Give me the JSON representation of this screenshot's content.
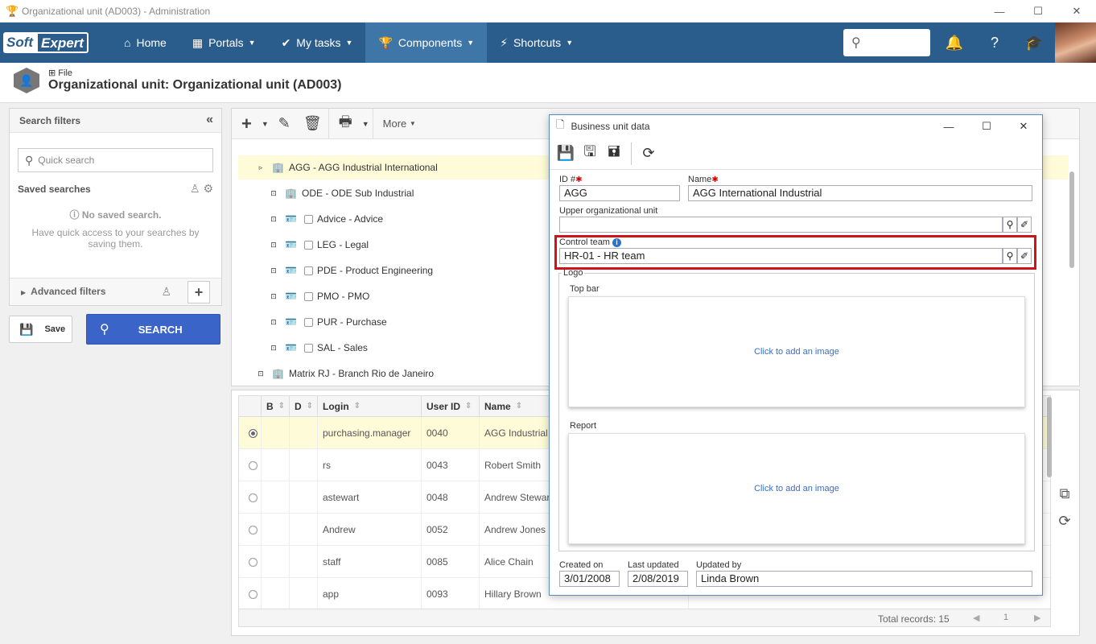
{
  "window": {
    "title": "Organizational unit (AD003) - Administration"
  },
  "nav": {
    "logo_soft": "Soft",
    "logo_expert": "Expert",
    "items": [
      {
        "label": "Home",
        "icon": "home-icon"
      },
      {
        "label": "Portals",
        "icon": "grid-icon"
      },
      {
        "label": "My tasks",
        "icon": "check-icon"
      },
      {
        "label": "Components",
        "icon": "trophy-icon"
      },
      {
        "label": "Shortcuts",
        "icon": "bolt-icon"
      }
    ],
    "active": "Components"
  },
  "page": {
    "file_label": "File",
    "title": "Organizational unit: Organizational unit (AD003)"
  },
  "filters": {
    "header": "Search filters",
    "quick_search_placeholder": "Quick search",
    "saved_searches": "Saved searches",
    "no_saved": "No saved search.",
    "no_saved_desc": "Have quick access to your searches by saving them.",
    "advanced": "Advanced filters",
    "save_label": "Save",
    "search_label": "SEARCH"
  },
  "toolbar": {
    "more_label": "More"
  },
  "tree": [
    {
      "label": "AGG - AGG Industrial International",
      "level": 0,
      "type": "org",
      "expand": "▹",
      "selected": true,
      "checkbox": false
    },
    {
      "label": "ODE - ODE Sub Industrial",
      "level": 1,
      "type": "org",
      "expand": "⊡",
      "selected": false,
      "checkbox": false
    },
    {
      "label": "Advice - Advice",
      "level": 1,
      "type": "unit",
      "expand": "⊡",
      "selected": false,
      "checkbox": true
    },
    {
      "label": "LEG - Legal",
      "level": 1,
      "type": "unit",
      "expand": "⊡",
      "selected": false,
      "checkbox": true
    },
    {
      "label": "PDE - Product Engineering",
      "level": 1,
      "type": "unit",
      "expand": "⊡",
      "selected": false,
      "checkbox": true
    },
    {
      "label": "PMO - PMO",
      "level": 1,
      "type": "unit",
      "expand": "⊡",
      "selected": false,
      "checkbox": true
    },
    {
      "label": "PUR - Purchase",
      "level": 1,
      "type": "unit",
      "expand": "⊡",
      "selected": false,
      "checkbox": true
    },
    {
      "label": "SAL - Sales",
      "level": 1,
      "type": "unit",
      "expand": "⊡",
      "selected": false,
      "checkbox": true
    },
    {
      "label": "Matrix RJ - Branch Rio de Janeiro",
      "level": 0,
      "type": "org",
      "expand": "⊡",
      "selected": false,
      "checkbox": false
    }
  ],
  "grid": {
    "headers": {
      "b": "B",
      "d": "D",
      "login": "Login",
      "user_id": "User ID",
      "name": "Name"
    },
    "rows": [
      {
        "login": "purchasing.manager",
        "user_id": "0040",
        "name": "AGG Industrial",
        "selected": true
      },
      {
        "login": "rs",
        "user_id": "0043",
        "name": "Robert Smith",
        "selected": false
      },
      {
        "login": "astewart",
        "user_id": "0048",
        "name": "Andrew Stewart",
        "selected": false
      },
      {
        "login": "Andrew",
        "user_id": "0052",
        "name": "Andrew Jones",
        "selected": false
      },
      {
        "login": "staff",
        "user_id": "0085",
        "name": "Alice Chain",
        "selected": false
      },
      {
        "login": "app",
        "user_id": "0093",
        "name": "Hillary Brown",
        "selected": false
      }
    ],
    "total_label": "Total records: 15",
    "page": "1"
  },
  "dialog": {
    "title": "Business unit data",
    "id_label": "ID #",
    "id_value": "AGG",
    "name_label": "Name",
    "name_value": "AGG International Industrial",
    "upper_label": "Upper organizational unit",
    "upper_value": "",
    "control_label": "Control team",
    "control_value": "HR-01 - HR team",
    "logo_label": "Logo",
    "top_bar_label": "Top bar",
    "report_label": "Report",
    "add_image": "Click to add an image",
    "created_label": "Created on",
    "created_value": "3/01/2008",
    "updated_label": "Last updated",
    "updated_value": "2/08/2019",
    "updated_by_label": "Updated by",
    "updated_by_value": "Linda Brown"
  }
}
